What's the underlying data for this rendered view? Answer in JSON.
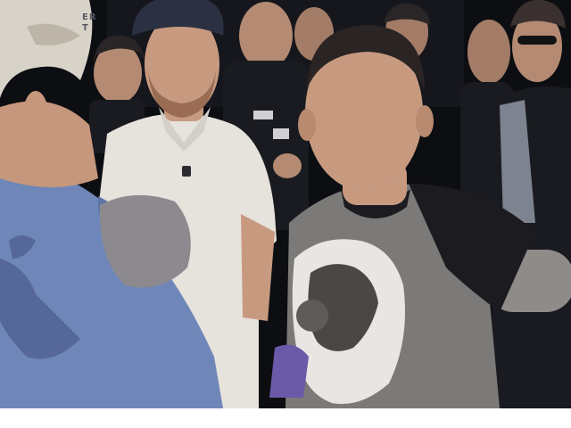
{
  "scene": {
    "background_color": "#0d0e12",
    "letterbox_color": "#ffffff",
    "banner_text": "ER\nT",
    "banner_text_color": "#5a5a62"
  },
  "colors": {
    "left_person_shirt": "#6f86b8",
    "left_person_shirt_pattern": "#56679a",
    "left_person_hair": "#d8d3c8",
    "center_person_shirt": "#e6e2dc",
    "center_person_beanie": "#2b3142",
    "right_person_shirt": "#7c7a78",
    "right_person_sleeve": "#1c1c20",
    "right_person_shirt_print": "#e8e6e2",
    "crowd_clothing": "#1a1b20",
    "skin_tone": "#c79a80",
    "audience_skin": "#b48a72"
  }
}
